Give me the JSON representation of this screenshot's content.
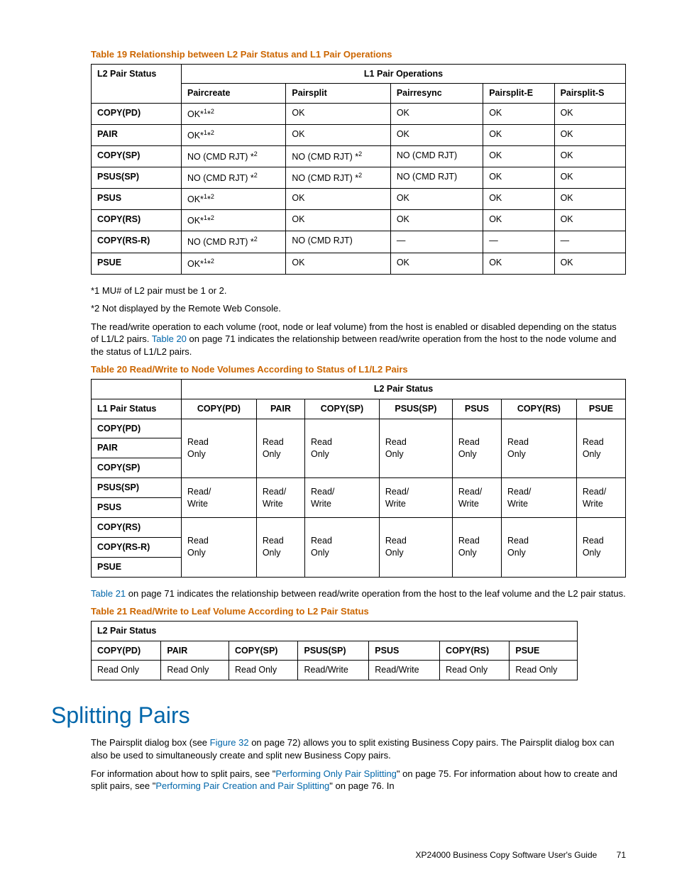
{
  "table19": {
    "caption": "Table 19 Relationship between L2 Pair Status and L1 Pair Operations",
    "h_l2": "L2 Pair Status",
    "h_l1ops": "L1 Pair Operations",
    "cols": [
      "Paircreate",
      "Pairsplit",
      "Pairresync",
      "Pairsplit-E",
      "Pairsplit-S"
    ],
    "rows": [
      {
        "s": "COPY(PD)",
        "c": [
          "OK*1*2",
          "OK",
          "OK",
          "OK",
          "OK"
        ]
      },
      {
        "s": "PAIR",
        "c": [
          "OK*1*2",
          "OK",
          "OK",
          "OK",
          "OK"
        ]
      },
      {
        "s": "COPY(SP)",
        "c": [
          "NO (CMD RJT) *2",
          "NO (CMD RJT) *2",
          "NO (CMD RJT)",
          "OK",
          "OK"
        ]
      },
      {
        "s": "PSUS(SP)",
        "c": [
          "NO (CMD RJT) *2",
          "NO (CMD RJT) *2",
          "NO (CMD RJT)",
          "OK",
          "OK"
        ]
      },
      {
        "s": "PSUS",
        "c": [
          "OK*1*2",
          "OK",
          "OK",
          "OK",
          "OK"
        ]
      },
      {
        "s": "COPY(RS)",
        "c": [
          "OK*1*2",
          "OK",
          "OK",
          "OK",
          "OK"
        ]
      },
      {
        "s": "COPY(RS-R)",
        "c": [
          "NO (CMD RJT) *2",
          "NO (CMD RJT)",
          "—",
          "—",
          "—"
        ]
      },
      {
        "s": "PSUE",
        "c": [
          "OK*1*2",
          "OK",
          "OK",
          "OK",
          "OK"
        ]
      }
    ]
  },
  "notes": {
    "n1": "*1 MU# of L2 pair must be 1 or 2.",
    "n2": "*2 Not displayed by the Remote Web Console."
  },
  "para1a": "The read/write operation to each volume (root, node or leaf volume) from the host is enabled or disabled depending on the status of L1/L2 pairs. ",
  "para1link": "Table 20",
  "para1b": " on page 71 indicates the relationship between read/write operation from the host to the node volume and the status of L1/L2 pairs.",
  "table20": {
    "caption": "Table 20 Read/Write to Node Volumes According to Status of L1/L2 Pairs",
    "h_blank": "",
    "h_group": "L2 Pair Status",
    "h_l1": "L1 Pair Status",
    "cols": [
      "COPY(PD)",
      "PAIR",
      "COPY(SP)",
      "PSUS(SP)",
      "PSUS",
      "COPY(RS)",
      "PSUE"
    ],
    "groups": [
      {
        "rows": [
          "COPY(PD)",
          "PAIR",
          "COPY(SP)"
        ],
        "val": "Read Only"
      },
      {
        "rows": [
          "PSUS(SP)",
          "PSUS"
        ],
        "val": "Read/ Write"
      },
      {
        "rows": [
          "COPY(RS)",
          "COPY(RS-R)",
          "PSUE"
        ],
        "val": "Read Only"
      }
    ]
  },
  "para2link": "Table 21",
  "para2b": " on page 71 indicates the relationship between read/write operation from the host to the leaf volume and the L2 pair status.",
  "table21": {
    "caption": "Table 21 Read/Write to Leaf Volume According to L2 Pair Status",
    "h_group": "L2 Pair Status",
    "cols": [
      "COPY(PD)",
      "PAIR",
      "COPY(SP)",
      "PSUS(SP)",
      "PSUS",
      "COPY(RS)",
      "PSUE"
    ],
    "vals": [
      "Read Only",
      "Read Only",
      "Read Only",
      "Read/Write",
      "Read/Write",
      "Read Only",
      "Read Only"
    ]
  },
  "section_title": "Splitting Pairs",
  "sp_p1a": "The Pairsplit dialog box (see ",
  "sp_p1link": "Figure 32",
  "sp_p1b": " on page 72) allows you to split existing Business Copy pairs. The Pairsplit dialog box can also be used to simultaneously create and split new Business Copy pairs.",
  "sp_p2a": "For information about how to split pairs, see \"",
  "sp_p2link1": "Performing Only Pair Splitting",
  "sp_p2b": "\" on page 75. For information about how to create and split pairs, see \"",
  "sp_p2link2": "Performing Pair Creation and Pair Splitting",
  "sp_p2c": "\" on page 76. In",
  "footer_text": "XP24000 Business Copy Software User's Guide",
  "page_num": "71"
}
